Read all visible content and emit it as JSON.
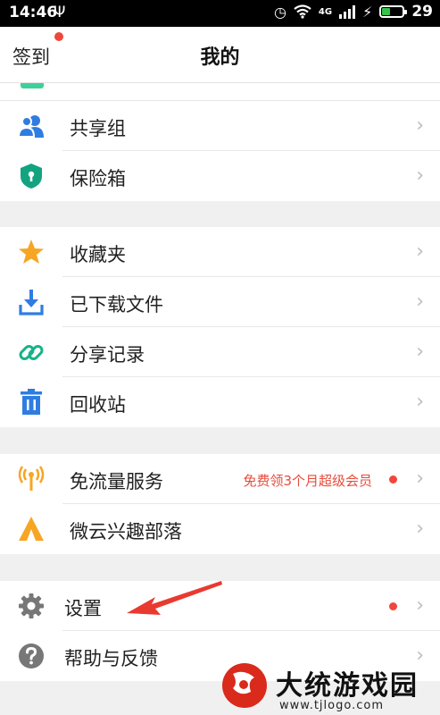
{
  "status_bar": {
    "time": "14:46",
    "battery_level": "29",
    "network_label": "4G"
  },
  "header": {
    "checkin_label": "签到",
    "title": "我的"
  },
  "groups": [
    {
      "items": [
        {
          "label": "共享组",
          "icon": "share-group-icon",
          "color": "#2f7de1"
        },
        {
          "label": "保险箱",
          "icon": "safe-box-icon",
          "color": "#14a37f"
        }
      ]
    },
    {
      "items": [
        {
          "label": "收藏夹",
          "icon": "star-icon",
          "color": "#f6a623"
        },
        {
          "label": "已下载文件",
          "icon": "download-icon",
          "color": "#2f7de1"
        },
        {
          "label": "分享记录",
          "icon": "link-icon",
          "color": "#17b28a"
        },
        {
          "label": "回收站",
          "icon": "trash-icon",
          "color": "#2f7de1"
        }
      ]
    },
    {
      "items": [
        {
          "label": "免流量服务",
          "icon": "signal-tower-icon",
          "color": "#f6a623",
          "promo": "免费领3个月超级会员"
        },
        {
          "label": "微云兴趣部落",
          "icon": "tent-icon",
          "color": "#f6a623"
        }
      ]
    },
    {
      "items": [
        {
          "label": "设置",
          "icon": "gear-icon",
          "color": "#777777"
        },
        {
          "label": "帮助与反馈",
          "icon": "help-icon",
          "color": "#777777"
        }
      ]
    }
  ],
  "watermark": {
    "title": "大统游戏园",
    "url": "www.tjlogo.com"
  },
  "colors": {
    "accent_red": "#f0473b",
    "promo_text": "#e64c3c"
  }
}
